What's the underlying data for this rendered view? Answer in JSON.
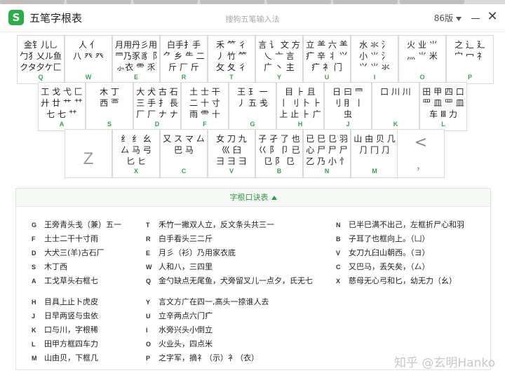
{
  "window": {
    "app_title": "五笔字根表",
    "logo_glyph": "S",
    "center_title": "搜狗五笔输入法",
    "version": "86版",
    "close_glyph": "✕"
  },
  "keys": [
    {
      "letter": "Q",
      "rows": [
        "金钅儿乚",
        "勹犭乂ル鱼",
        "クタ夕ケ匚"
      ]
    },
    {
      "letter": "W",
      "rows": [
        "人    亻",
        "八 癶 癶",
        ""
      ]
    },
    {
      "letter": "E",
      "rows": [
        "月用丹彡用",
        "⺜乃豕豸⻏",
        "⺗衣 ⻗ 乑"
      ]
    },
    {
      "letter": "R",
      "rows": [
        "白手扌手",
        "⺈ 乡 ⺧ 二",
        "斤 厂 斤"
      ]
    },
    {
      "letter": "T",
      "rows": [
        "禾 ⺮ 彳",
        "丿 竹 ⺮",
        "攵 夂 彳"
      ]
    },
    {
      "letter": "Y",
      "rows": [
        "言 讠 文 方",
        "乀 亠 言",
        "广 丶 主"
      ]
    },
    {
      "letter": "U",
      "rows": [
        "立 ⺷ 六 ⺷",
        "疒 辛 丬 ⺍",
        "疒 衤 门"
      ]
    },
    {
      "letter": "I",
      "rows": [
        "水 氺 氵",
        "小 ⺌ 氵",
        "⺍ ⺌ 氺"
      ]
    },
    {
      "letter": "O",
      "rows": [
        "火 业 ⺌",
        "灬 ⺌ 米",
        ""
      ]
    },
    {
      "letter": "P",
      "rows": [
        "之 辶 廴",
        "宀 冖 礻",
        ""
      ]
    },
    {
      "letter": "A",
      "rows": [
        "工 戈 弋 匚",
        "廾 廿 艹 ⺿",
        "七 七 ⺿"
      ]
    },
    {
      "letter": "S",
      "rows": [
        "木  丁",
        "西  覀",
        ""
      ]
    },
    {
      "letter": "D",
      "rows": [
        "大 犬 古 石",
        "三 手 ⺘ 長",
        "厂 厂 ナ ナ"
      ]
    },
    {
      "letter": "F",
      "rows": [
        "土 士 干",
        "二 十 寸",
        "雨 ⻗ 十"
      ]
    },
    {
      "letter": "G",
      "rows": [
        "王 ⺩ 一",
        "丿 五 戋",
        ""
      ]
    },
    {
      "letter": "H",
      "rows": [
        "目 ⺊ 且",
        "丨 刂 卜 ⺊",
        "上 止 ⺊ 广"
      ]
    },
    {
      "letter": "J",
      "rows": [
        "日 曰 ⺜",
        "刂 ⺝ 丨",
        "虫"
      ]
    },
    {
      "letter": "K",
      "rows": [
        "口 川 川",
        "",
        ""
      ]
    },
    {
      "letter": "L",
      "rows": [
        "田 甲 四 口",
        "罒 皿 罒 皿",
        "车 Ⅲ 力"
      ]
    },
    {
      "letter": "X",
      "rows": [
        "纟 纟 幺",
        "厶 马 弓",
        "匕 ヒ"
      ]
    },
    {
      "letter": "C",
      "rows": [
        "又 ス マ 厶",
        "巴  马",
        ""
      ]
    },
    {
      "letter": "V",
      "rows": [
        "女 刀 九",
        "巛  臼",
        "彐 ⺕ ⺕"
      ]
    },
    {
      "letter": "B",
      "rows": [
        "子 孑 了 也",
        "巜 阝 卩 已",
        "⺋ 阝 ⺋"
      ]
    },
    {
      "letter": "N",
      "rows": [
        "已 巳 ⺋ 羽",
        "心 尸 尸 尸",
        "乙 乃 小 忄"
      ]
    },
    {
      "letter": "M",
      "rows": [
        "山 由 贝 几",
        "⺆ 冂 ⺆",
        ""
      ]
    }
  ],
  "z_key": {
    "label": "Z"
  },
  "punct_key": {
    "top": "<",
    "bottom": "，"
  },
  "mnemonic": {
    "header": "字根口诀表",
    "left_col_1": [
      {
        "letter": "G",
        "text": "王旁青头戋（兼）五一"
      },
      {
        "letter": "F",
        "text": "土士二干十寸雨"
      },
      {
        "letter": "D",
        "text": "大犬三(羊)古石厂"
      },
      {
        "letter": "S",
        "text": "木丁西"
      },
      {
        "letter": "A",
        "text": "工戈草头右框七"
      }
    ],
    "mid_col_1": [
      {
        "letter": "T",
        "text": "禾竹一撇双人立，反文条头共三一"
      },
      {
        "letter": "R",
        "text": "白手看头三二斤"
      },
      {
        "letter": "E",
        "text": "月彡（衫）乃用家衣底"
      },
      {
        "letter": "W",
        "text": "人和八，三四里"
      },
      {
        "letter": "Q",
        "text": "金勺缺点无尾鱼，犬旁留叉儿一点夕，氏无七"
      }
    ],
    "right_col_1": [
      {
        "letter": "N",
        "text": "已半巳满不出己，左框折尸心和羽"
      },
      {
        "letter": "B",
        "text": "子耳了也框向上。（凵）"
      },
      {
        "letter": "V",
        "text": "女刀九臼山朝西。（ヨ）"
      },
      {
        "letter": "C",
        "text": "又巴马，丢矢矣，（厶）"
      },
      {
        "letter": "X",
        "text": "慈母无心弓和匕，幼无力（幺）"
      }
    ],
    "left_col_2": [
      {
        "letter": "H",
        "text": "目具上止卜虎皮"
      },
      {
        "letter": "J",
        "text": "日早两竖与虫依"
      },
      {
        "letter": "K",
        "text": "口与川，字根稀"
      },
      {
        "letter": "L",
        "text": "田甲方框四车力"
      },
      {
        "letter": "M",
        "text": "山由贝，下框几"
      }
    ],
    "mid_col_2": [
      {
        "letter": "Y",
        "text": "言文方广在四一,高头一捺谁人去"
      },
      {
        "letter": "U",
        "text": "立辛两点六门疒"
      },
      {
        "letter": "I",
        "text": "水旁兴头小倒立"
      },
      {
        "letter": "O",
        "text": "火业头，四点米"
      },
      {
        "letter": "P",
        "text": "之字军，摘礻（示）衤（衣）"
      }
    ]
  },
  "watermark": "知乎 @玄明Hanko"
}
